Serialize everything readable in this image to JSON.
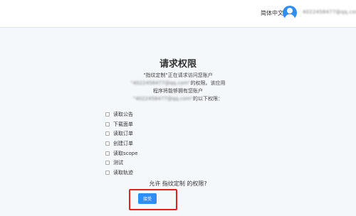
{
  "header": {
    "language_label": "简体中文",
    "user_account": "4022458477@qq.com"
  },
  "main": {
    "title": "请求权限",
    "desc_line1": "\"指纹定制\"正在请求访问您账户",
    "desc_account": "\"4022458477@qq.com\"",
    "desc_line2_suffix": "的权限。该应用",
    "desc_line3": "程序将能够拥有您账户",
    "desc_line4_suffix": "的以下权限：",
    "permissions": [
      "读取公告",
      "下载面单",
      "读取订单",
      "创建订单",
      "读取scope",
      "测试",
      "读取轨迹"
    ],
    "question": "允许 指纹定制 的权限?",
    "accept_label": "接受"
  },
  "colors": {
    "accent": "#2f8ef4",
    "highlight_border": "#e62020",
    "background": "#f4f8fb"
  }
}
